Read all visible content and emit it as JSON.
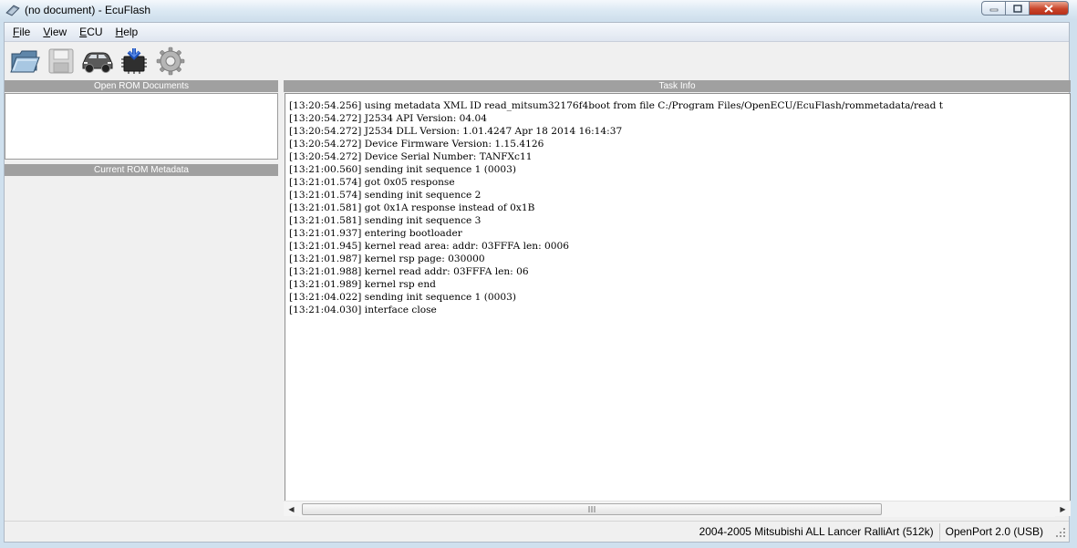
{
  "window": {
    "title": "(no document) - EcuFlash"
  },
  "menu": {
    "items": [
      {
        "label_ul": "F",
        "label_rest": "ile"
      },
      {
        "label_ul": "V",
        "label_rest": "iew"
      },
      {
        "label_ul": "E",
        "label_rest": "CU"
      },
      {
        "label_ul": "H",
        "label_rest": "elp"
      }
    ]
  },
  "toolbar": {
    "icons": [
      "open-folder-icon",
      "save-disk-icon",
      "car-icon",
      "ecu-chip-icon",
      "gear-icon"
    ]
  },
  "panels": {
    "open_rom": "Open ROM Documents",
    "rom_metadata": "Current ROM Metadata",
    "task_info": "Task Info"
  },
  "log": {
    "lines": [
      "[13:20:54.256] using metadata XML ID read_mitsum32176f4boot from file C:/Program Files/OpenECU/EcuFlash/rommetadata/read t",
      "[13:20:54.272] J2534 API Version: 04.04",
      "[13:20:54.272] J2534 DLL Version: 1.01.4247 Apr 18 2014 16:14:37",
      "[13:20:54.272] Device Firmware Version: 1.15.4126",
      "[13:20:54.272] Device Serial Number: TANFXc11",
      "[13:21:00.560] sending init sequence 1 (0003)",
      "[13:21:01.574] got 0x05 response",
      "[13:21:01.574] sending init sequence 2",
      "[13:21:01.581] got 0x1A response instead of 0x1B",
      "[13:21:01.581] sending init sequence 3",
      "[13:21:01.937] entering bootloader",
      "[13:21:01.945] kernel read area: addr: 03FFFA len: 0006",
      "[13:21:01.987] kernel rsp page: 030000",
      "[13:21:01.988] kernel read addr: 03FFFA len: 06",
      "[13:21:01.989] kernel rsp end",
      "[13:21:04.022] sending init sequence 1 (0003)",
      "[13:21:04.030] interface close"
    ]
  },
  "status": {
    "vehicle": "2004-2005 Mitsubishi ALL Lancer RalliArt (512k)",
    "interface": "OpenPort 2.0 (USB)"
  },
  "colors": {
    "panel_header": "#a0a0a0",
    "close_button": "#c9452a"
  }
}
